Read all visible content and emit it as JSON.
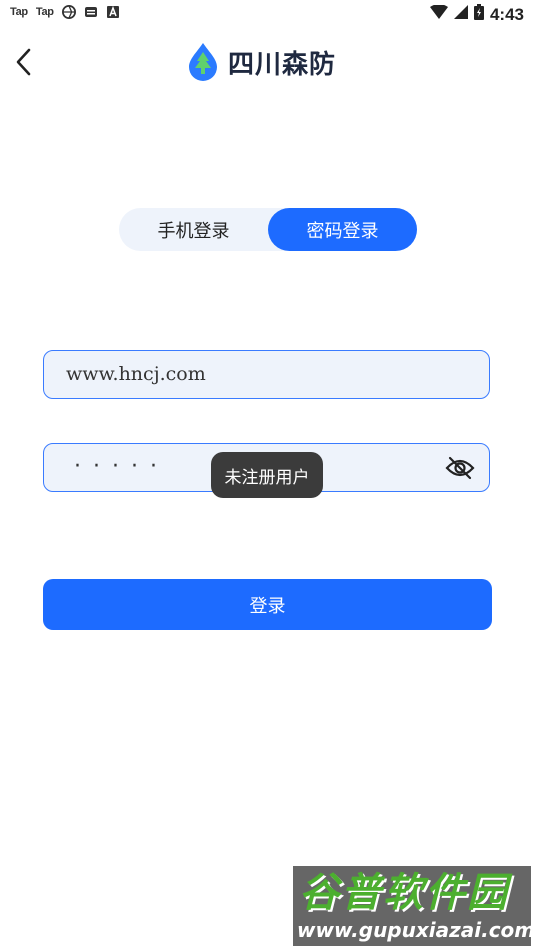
{
  "status_bar": {
    "app1": "Tap",
    "app2": "Tap",
    "time": "4:43"
  },
  "header": {
    "title": "四川森防",
    "back_icon": "chevron-left-icon",
    "logo_icon": "tree-drop-logo"
  },
  "tabs": [
    {
      "label": "手机登录",
      "active": false
    },
    {
      "label": "密码登录",
      "active": true
    }
  ],
  "form": {
    "username_value": "www.hncj.com",
    "password_mask": "·····",
    "eye_icon": "eye-off-icon"
  },
  "toast": {
    "message": "未注册用户"
  },
  "login_button": {
    "label": "登录"
  },
  "watermark": {
    "title": "谷普软件园",
    "url": "www.gupuxiazai.com"
  },
  "colors": {
    "primary": "#1d6bff",
    "field_bg": "#eef3fb",
    "field_border": "#3a7bff",
    "toast_bg": "#3b3b3b",
    "title": "#1f2940"
  }
}
